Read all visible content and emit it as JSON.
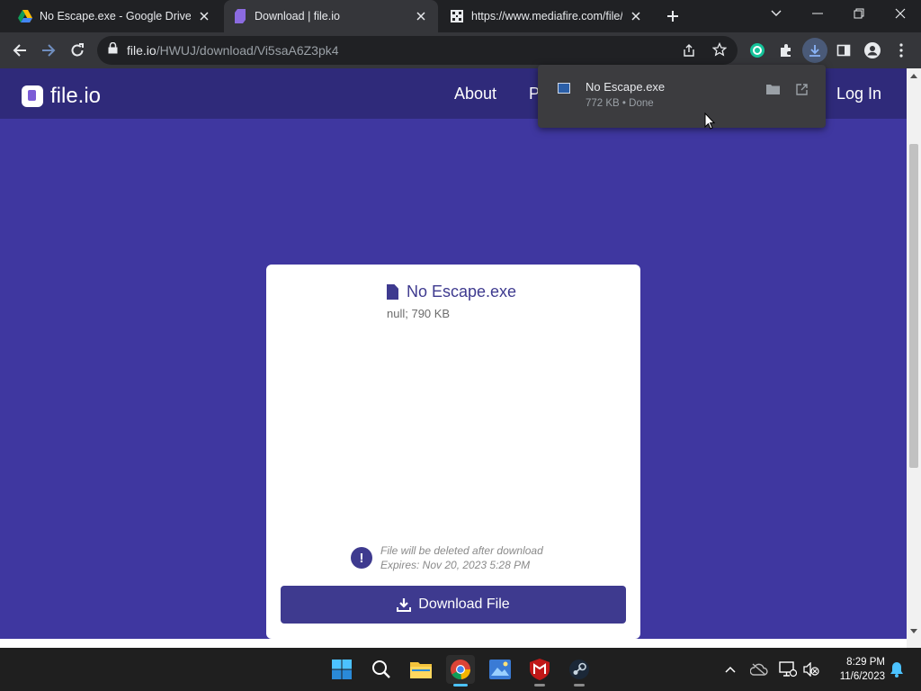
{
  "browser": {
    "tabs": [
      {
        "title": "No Escape.exe - Google Drive",
        "favicon": "google-drive-icon",
        "active": false
      },
      {
        "title": "Download | file.io",
        "favicon": "fileio-icon",
        "active": true
      },
      {
        "title": "https://www.mediafire.com/file/t",
        "favicon": "mediafire-icon",
        "active": false
      }
    ],
    "url_host": "file.io",
    "url_path": "/HWUJ/download/Vi5saA6Z3pk4"
  },
  "site": {
    "brand": "file.io",
    "nav": [
      "About",
      "P",
      "Log In"
    ]
  },
  "file": {
    "name": "No Escape.exe",
    "meta": "null; 790 KB",
    "notice_line1": "File will be deleted after download",
    "notice_line2": "Expires: Nov 20, 2023 5:28 PM",
    "download_label": "Download File"
  },
  "download_bubble": {
    "name": "No Escape.exe",
    "meta": "772 KB • Done"
  },
  "taskbar": {
    "time": "8:29 PM",
    "date": "11/6/2023"
  },
  "colors": {
    "page_bg": "#3f37a0",
    "header_bg": "#2f2a7a",
    "accent": "#3e3a8f"
  }
}
